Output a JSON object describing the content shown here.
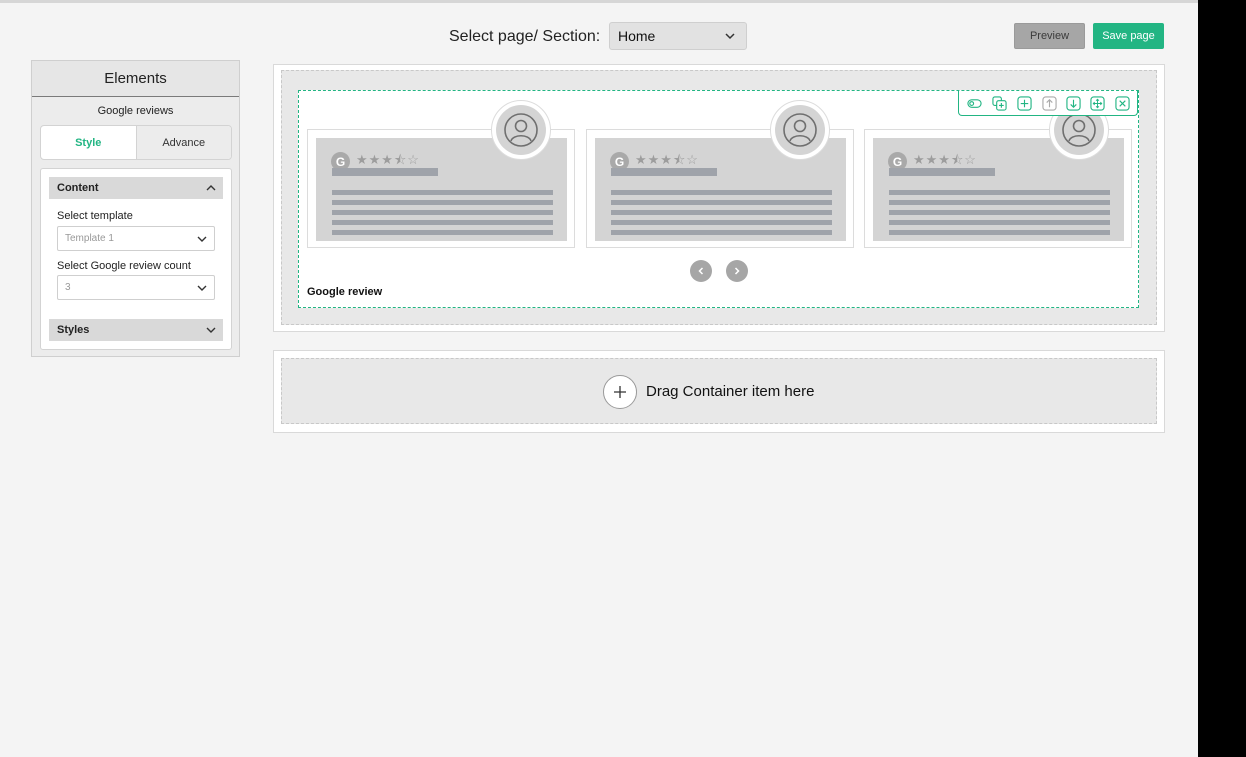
{
  "topbar": {
    "section_label": "Select page/ Section:",
    "page_select_value": "Home",
    "preview_label": "Preview",
    "save_label": "Save page"
  },
  "panel": {
    "title": "Elements",
    "subtitle": "Google reviews",
    "tabs": [
      {
        "label": "Style",
        "active": true
      },
      {
        "label": "Advance",
        "active": false
      }
    ],
    "content_section": {
      "title": "Content",
      "fields": [
        {
          "label": "Select template",
          "value": "Template 1"
        },
        {
          "label": "Select Google review count",
          "value": "3"
        }
      ]
    },
    "styles_section": {
      "title": "Styles"
    }
  },
  "canvas": {
    "widget_label": "Google review",
    "review_cards": [
      {
        "google_letter": "G",
        "rating": 3.5
      },
      {
        "google_letter": "G",
        "rating": 3.5
      },
      {
        "google_letter": "G",
        "rating": 3.5
      }
    ],
    "toolbar_icons": [
      "toggle-icon",
      "duplicate-icon",
      "add-icon",
      "move-up-icon",
      "move-down-icon",
      "move-icon",
      "close-icon"
    ],
    "drop_zone_text": "Drag Container item here"
  },
  "colors": {
    "accent": "#22b583",
    "preview_button": "#a6a6a6",
    "placeholder_gray": "#d4d4d4"
  }
}
